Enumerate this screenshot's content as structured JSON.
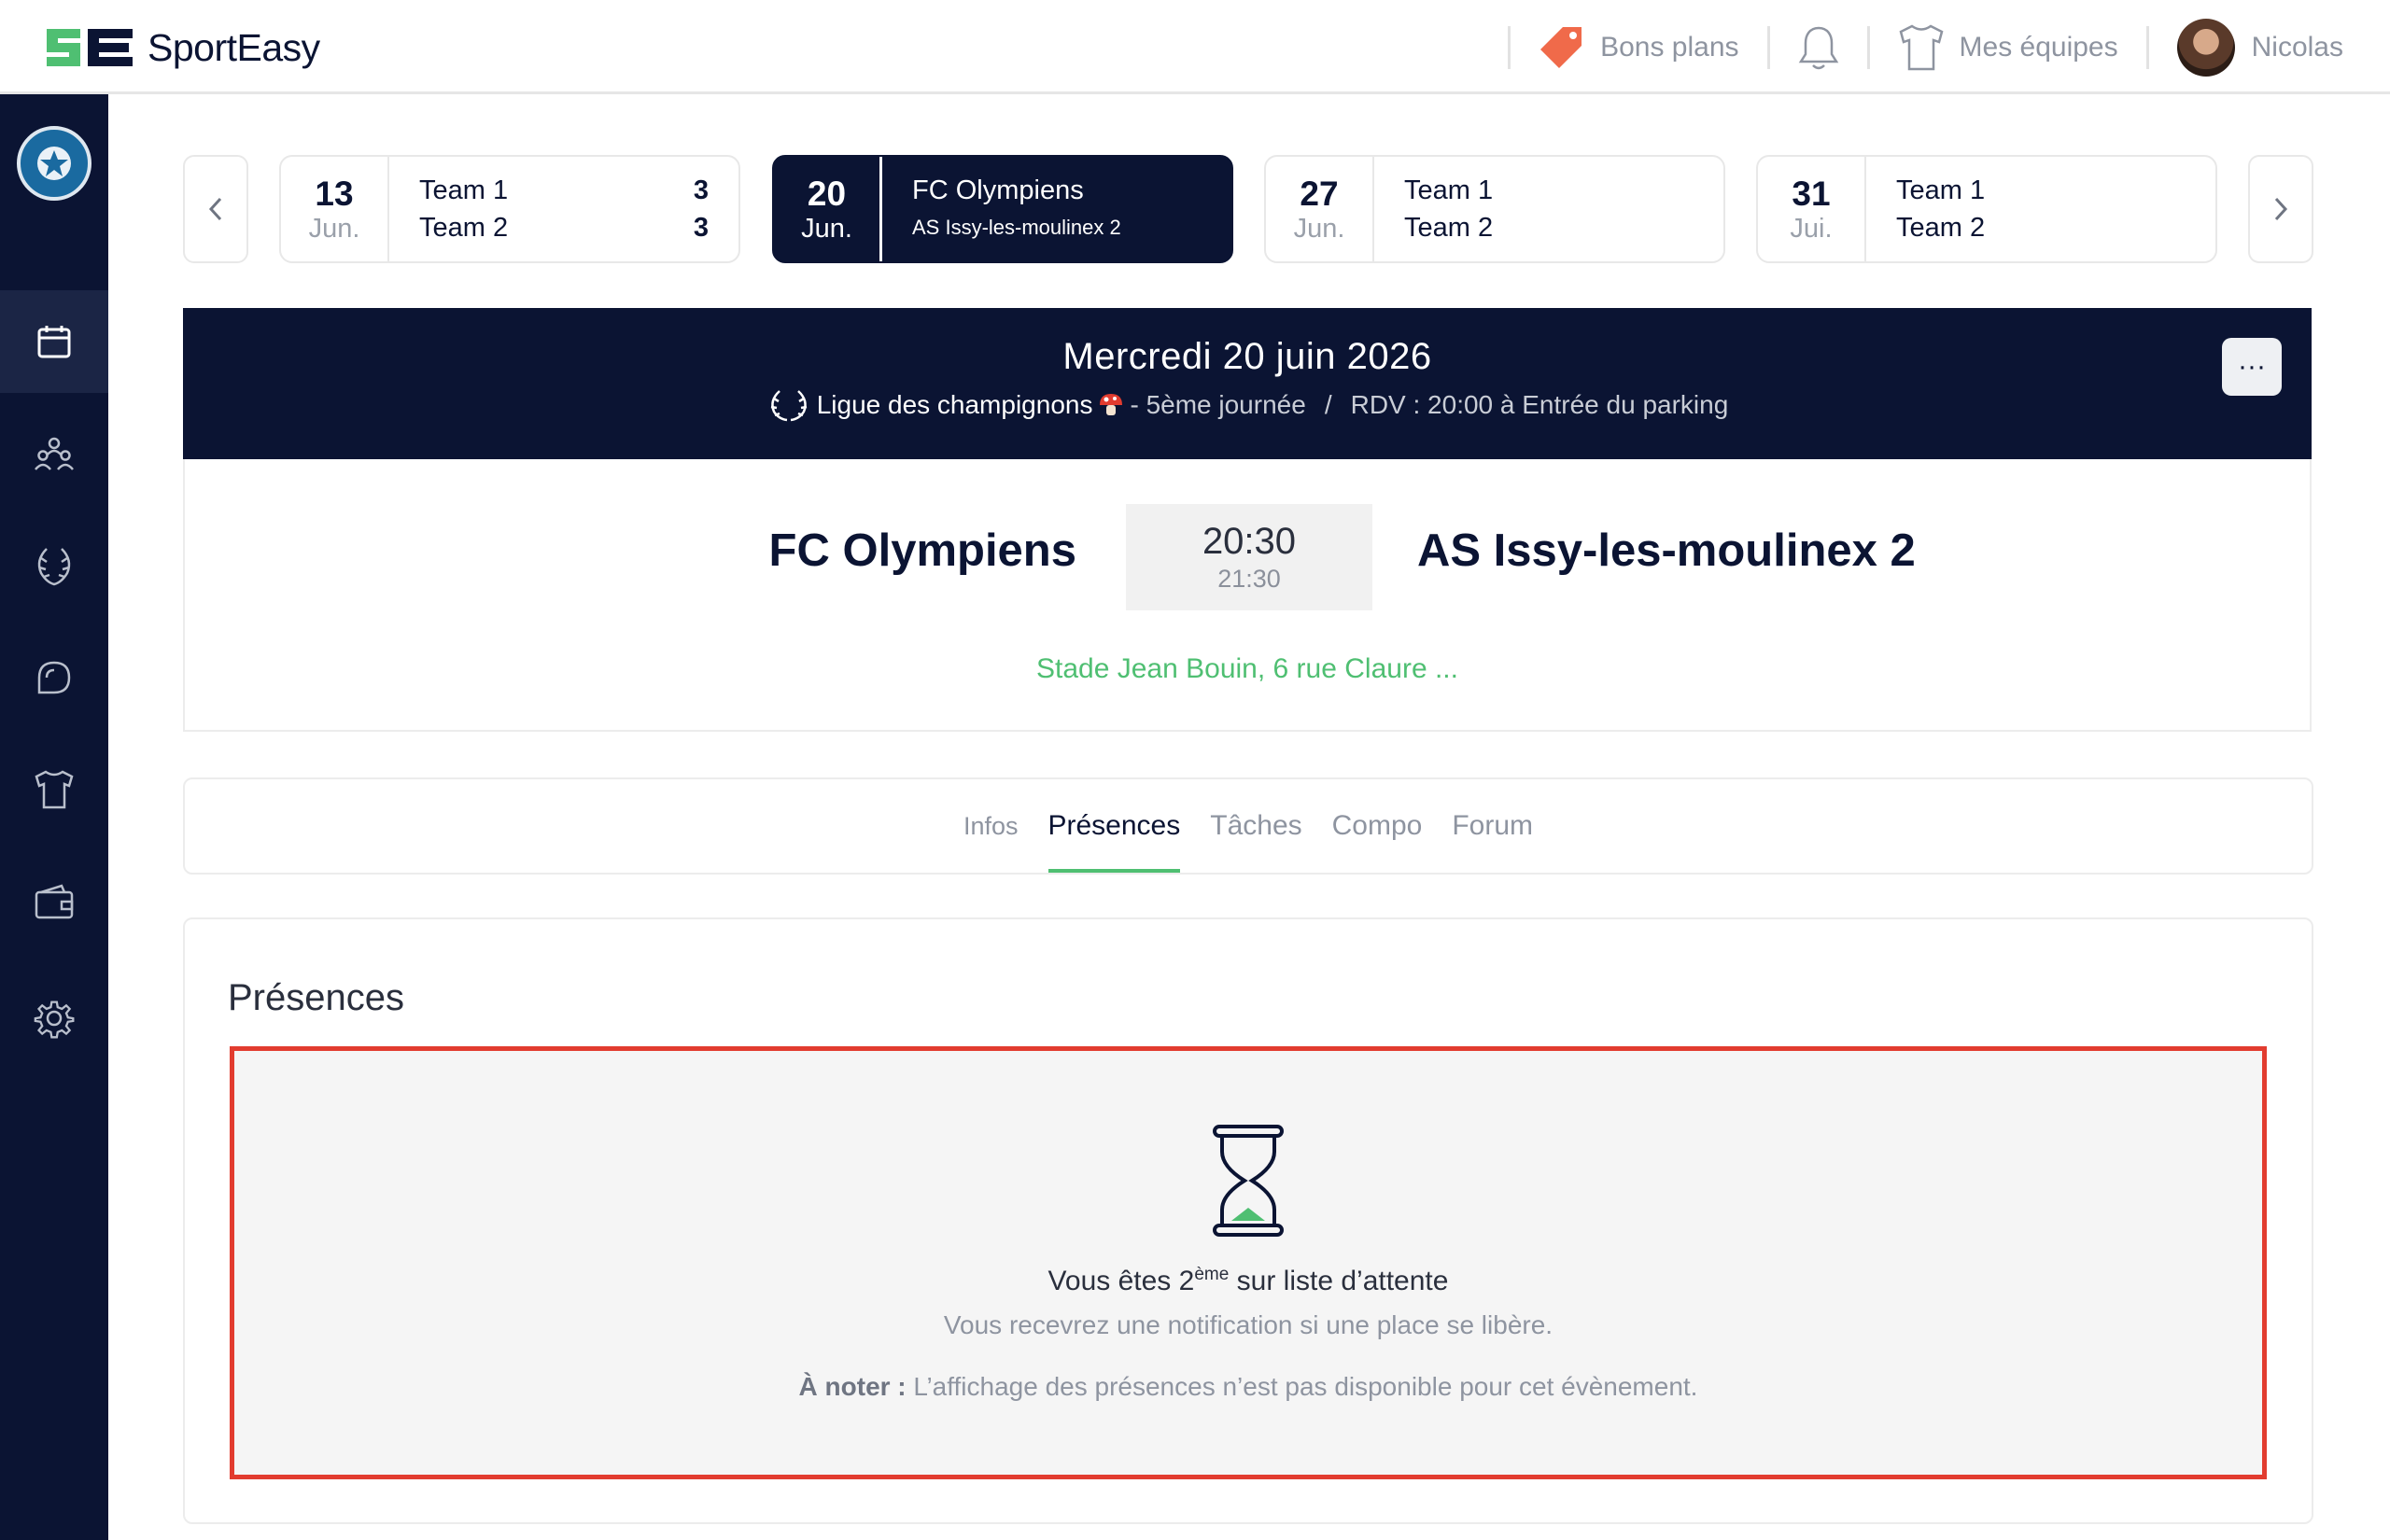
{
  "app": {
    "name": "SportEasy"
  },
  "topbar": {
    "deals_label": "Bons plans",
    "teams_label": "Mes équipes",
    "user_name": "Nicolas"
  },
  "date_strip": [
    {
      "day": "13",
      "month": "Jun.",
      "team1": "Team 1",
      "team2": "Team 2",
      "score1": "3",
      "score2": "3",
      "active": false
    },
    {
      "day": "20",
      "month": "Jun.",
      "team1": "FC Olympiens",
      "team2": "AS Issy-les-moulinex 2",
      "score1": "",
      "score2": "",
      "active": true
    },
    {
      "day": "27",
      "month": "Jun.",
      "team1": "Team 1",
      "team2": "Team 2",
      "score1": "",
      "score2": "",
      "active": false
    },
    {
      "day": "31",
      "month": "Jui.",
      "team1": "Team 1",
      "team2": "Team 2",
      "score1": "",
      "score2": "",
      "active": false
    }
  ],
  "event": {
    "date": "Mercredi 20 juin 2026",
    "competition": "Ligue des champignons",
    "round": "- 5ème journée",
    "separator": "/",
    "meeting": "RDV : 20:00 à Entrée du parking",
    "more_label": "···"
  },
  "match": {
    "home": "FC Olympiens",
    "away": "AS Issy-les-moulinex 2",
    "start": "20:30",
    "end": "21:30",
    "venue": "Stade Jean Bouin, 6 rue Claure ..."
  },
  "tabs": [
    "Infos",
    "Présences",
    "Tâches",
    "Compo",
    "Forum"
  ],
  "presences": {
    "title": "Présences",
    "waitlist_prefix": "Vous êtes 2",
    "waitlist_sup": "ème",
    "waitlist_suffix": " sur liste d’attente",
    "notify": "Vous recevrez une notification si une place se libère.",
    "note_label": "À noter :",
    "note_text": " L’affichage des présences n’est pas disponible pour cet évènement."
  },
  "colors": {
    "navy": "#0b1433",
    "green": "#4fbf72",
    "highlight": "#e23c2f",
    "deal": "#f06a4a"
  }
}
